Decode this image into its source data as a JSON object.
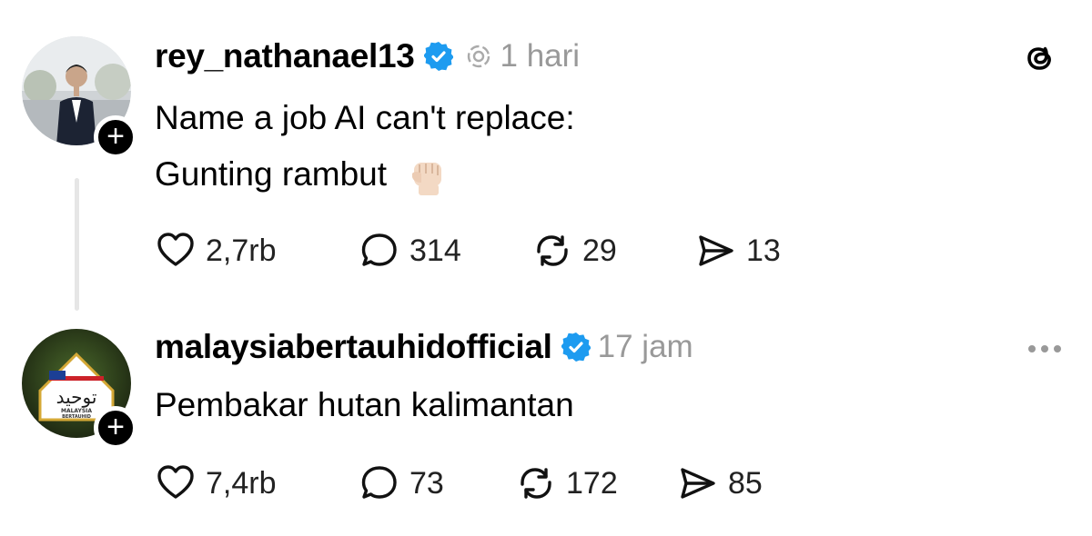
{
  "posts": [
    {
      "username": "rey_nathanael13",
      "verified": true,
      "time": "1 hari",
      "lines": [
        "Name a job AI can't replace:",
        "Gunting rambut"
      ],
      "emoji": "raised-fist-light-skin",
      "stats": {
        "likes": "2,7rb",
        "replies": "314",
        "reposts": "29",
        "shares": "13"
      }
    },
    {
      "username": "malaysiabertauhidofficial",
      "verified": true,
      "time": "17 jam",
      "lines": [
        "Pembakar hutan kalimantan"
      ],
      "avatar_text": {
        "arabic": "توحيد",
        "line1": "MALAYSIA",
        "line2": "BERTAUHID"
      },
      "stats": {
        "likes": "7,4rb",
        "replies": "73",
        "reposts": "172",
        "shares": "85"
      }
    }
  ],
  "icons": {
    "brand": "threads-logo",
    "more": "more-options-icon"
  },
  "colors": {
    "verified": "#1d9bf0",
    "muted": "#999999",
    "text": "#000000"
  }
}
